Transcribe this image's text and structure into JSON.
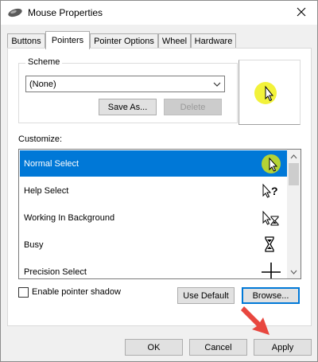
{
  "window": {
    "title": "Mouse Properties"
  },
  "tabs": [
    {
      "label": "Buttons"
    },
    {
      "label": "Pointers"
    },
    {
      "label": "Pointer Options"
    },
    {
      "label": "Wheel"
    },
    {
      "label": "Hardware"
    }
  ],
  "active_tab": "Pointers",
  "scheme": {
    "group_label": "Scheme",
    "selected": "(None)",
    "save_as_label": "Save As...",
    "delete_label": "Delete"
  },
  "customize": {
    "label": "Customize:",
    "items": [
      {
        "label": "Normal Select",
        "icon": "normal-select-icon",
        "selected": true
      },
      {
        "label": "Help Select",
        "icon": "help-select-icon"
      },
      {
        "label": "Working In Background",
        "icon": "working-background-icon"
      },
      {
        "label": "Busy",
        "icon": "busy-icon"
      },
      {
        "label": "Precision Select",
        "icon": "precision-select-icon"
      }
    ]
  },
  "shadow": {
    "label": "Enable pointer shadow",
    "checked": false
  },
  "buttons": {
    "use_default": "Use Default",
    "browse": "Browse...",
    "ok": "OK",
    "cancel": "Cancel",
    "apply": "Apply"
  },
  "colors": {
    "selection": "#0078d7",
    "highlight": "#f2f23a",
    "annotation_arrow": "#e8473f"
  }
}
